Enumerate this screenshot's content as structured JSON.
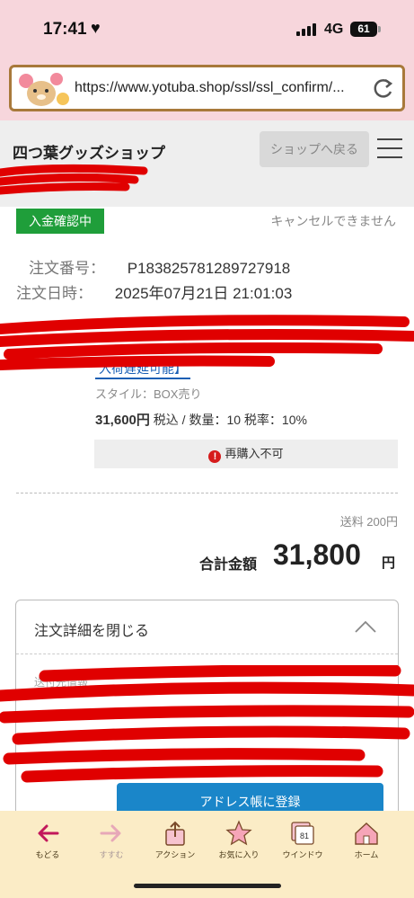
{
  "status_bar": {
    "time": "17:41",
    "network": "4G",
    "battery": "61"
  },
  "browser": {
    "url": "https://www.yotuba.shop/ssl/ssl_confirm/..."
  },
  "header": {
    "shop_name": "四つ葉グッズショップ",
    "back_label": "ショップへ戻る"
  },
  "order": {
    "status": "入金確認中",
    "cancel_note": "キャンセルできません",
    "number_label": "注文番号：",
    "number": "P183825781289727918",
    "date_label": "注文日時：",
    "date": "2025年07月21日 21:01:03"
  },
  "item": {
    "badge": "入荷遅延可能】",
    "style": "スタイル：BOX売り",
    "price": "31,600円",
    "price_detail": " 税込 / 数量：10 税率：10%",
    "rebuy": "再購入不可"
  },
  "totals": {
    "shipping": "送料 200円",
    "total_label": "合計金額",
    "total_value": "31,800",
    "total_unit": "円"
  },
  "details": {
    "toggle_label": "注文詳細を閉じる",
    "sub_label": "送付先情報",
    "address_button": "アドレス帳に登録"
  },
  "toolbar": {
    "items": [
      {
        "label": "もどる",
        "icon": "arrow-left-icon"
      },
      {
        "label": "すすむ",
        "icon": "arrow-right-icon"
      },
      {
        "label": "アクション",
        "icon": "share-icon"
      },
      {
        "label": "お気に入り",
        "icon": "star-icon"
      },
      {
        "label": "ウインドウ",
        "icon": "windows-icon",
        "count": "81"
      },
      {
        "label": "ホーム",
        "icon": "home-icon"
      }
    ]
  },
  "colors": {
    "chrome_pink": "#f7d6dc",
    "status_green": "#1f9e3a",
    "button_blue": "#1a86c9",
    "toolbar_cream": "#fbecc6",
    "redaction": "#e00000"
  }
}
